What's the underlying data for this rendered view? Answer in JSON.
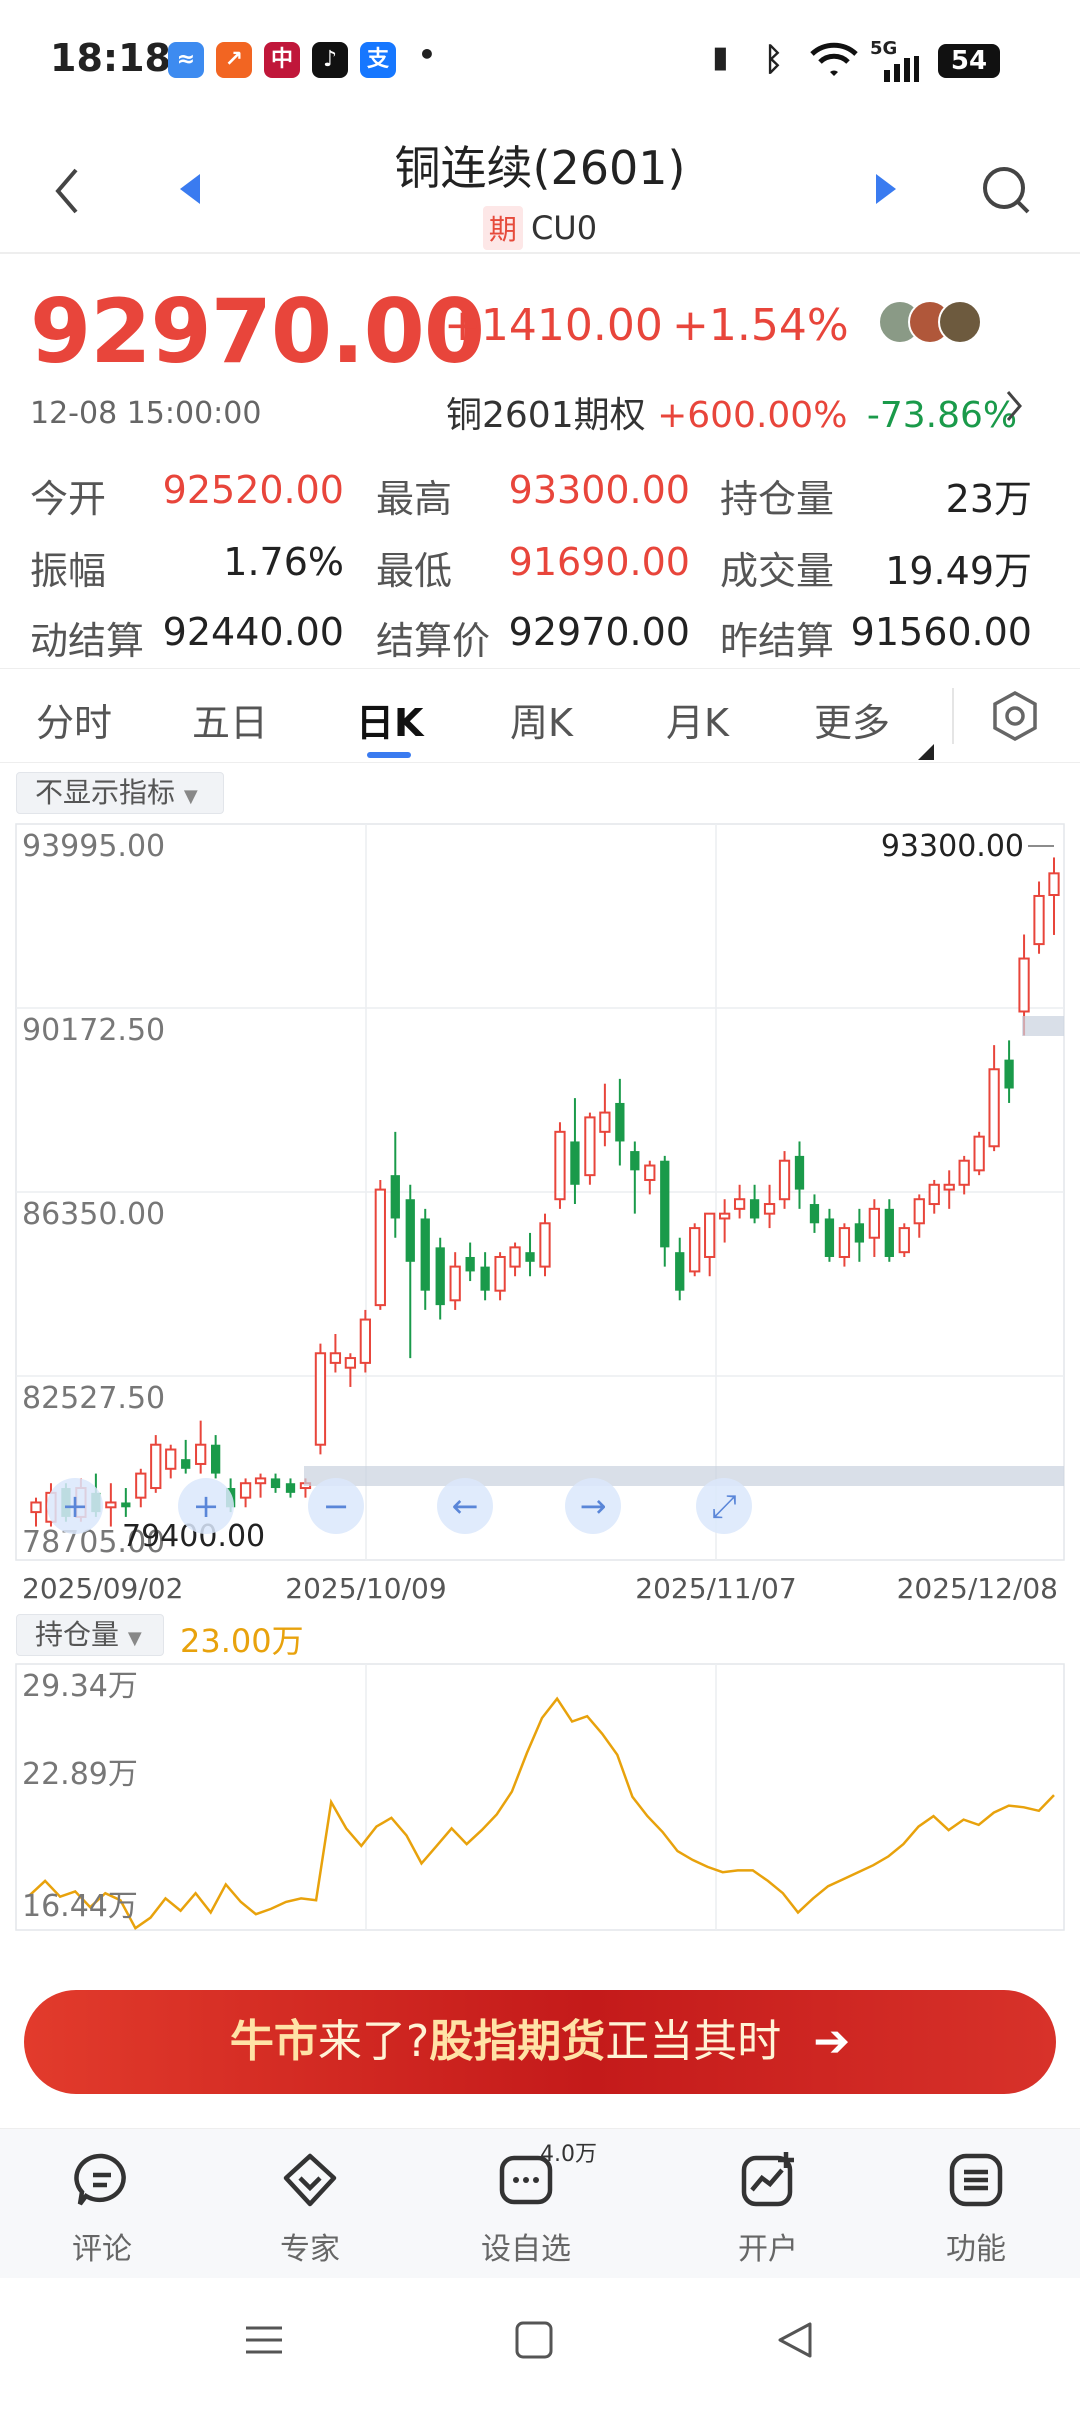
{
  "status_bar": {
    "time": "18:18",
    "battery": "54",
    "signal": "5G",
    "app_icons": [
      {
        "name": "app-icon-blue",
        "color": "#3d8bf0",
        "glyph": "≈"
      },
      {
        "name": "app-icon-orange",
        "color": "#f26522",
        "glyph": "↗"
      },
      {
        "name": "app-icon-red",
        "color": "#c0173a",
        "glyph": "中"
      },
      {
        "name": "app-icon-tiktok",
        "color": "#111111",
        "glyph": "♪"
      },
      {
        "name": "app-icon-alipay",
        "color": "#1677ff",
        "glyph": "支"
      }
    ]
  },
  "nav": {
    "title": "铜连续(2601)",
    "tag": "期",
    "code": "CU0"
  },
  "quote": {
    "price": "92970.00",
    "change": "+1410.00",
    "change_pct": "+1.54%",
    "datetime": "12-08 15:00:00",
    "option_label": "铜2601期权",
    "option_up": "+600.00%",
    "option_down": "-73.86%"
  },
  "stats": [
    [
      {
        "label": "今开",
        "value": "92520.00",
        "color": "red"
      },
      {
        "label": "最高",
        "value": "93300.00",
        "color": "red"
      },
      {
        "label": "持仓量",
        "value": "23万",
        "color": "dark"
      }
    ],
    [
      {
        "label": "振幅",
        "value": "1.76%",
        "color": "dark"
      },
      {
        "label": "最低",
        "value": "91690.00",
        "color": "red"
      },
      {
        "label": "成交量",
        "value": "19.49万",
        "color": "dark"
      }
    ],
    [
      {
        "label": "动结算",
        "value": "92440.00",
        "color": "dark"
      },
      {
        "label": "结算价",
        "value": "92970.00",
        "color": "dark"
      },
      {
        "label": "昨结算",
        "value": "91560.00",
        "color": "dark"
      }
    ]
  ],
  "tabs": [
    "分时",
    "五日",
    "日K",
    "周K",
    "月K",
    "更多"
  ],
  "active_tab": "日K",
  "indicator_label": "不显示指标",
  "chart_data": [
    {
      "type": "candlestick",
      "title": "",
      "y_ticks": [
        "93995.00",
        "90172.50",
        "86350.00",
        "82527.50",
        "78705.00"
      ],
      "ylim": [
        78705,
        93995
      ],
      "x_ticks": [
        "2025/09/02",
        "2025/10/09",
        "2025/11/07",
        "2025/12/08"
      ],
      "annotations": {
        "high_label": "93300.00",
        "low_label": "79400.00"
      },
      "candles": [
        [
          79700,
          80000,
          79400,
          79900
        ],
        [
          79500,
          80300,
          79400,
          80100
        ],
        [
          80200,
          80300,
          79500,
          79600
        ],
        [
          79600,
          80400,
          79500,
          80200
        ],
        [
          80100,
          80500,
          79600,
          79700
        ],
        [
          79800,
          80300,
          79400,
          79900
        ],
        [
          79900,
          80200,
          79600,
          79800
        ],
        [
          80000,
          80600,
          79800,
          80500
        ],
        [
          80200,
          81300,
          80100,
          81100
        ],
        [
          80600,
          81100,
          80400,
          81000
        ],
        [
          80800,
          81200,
          80500,
          80600
        ],
        [
          80700,
          81600,
          80500,
          81100
        ],
        [
          81100,
          81300,
          80400,
          80500
        ],
        [
          80200,
          80400,
          79700,
          79800
        ],
        [
          80000,
          80400,
          79800,
          80300
        ],
        [
          80300,
          80500,
          80000,
          80400
        ],
        [
          80400,
          80500,
          80100,
          80200
        ],
        [
          80300,
          80400,
          80000,
          80100
        ],
        [
          80200,
          80400,
          80000,
          80300
        ],
        [
          81100,
          83200,
          80900,
          83000
        ],
        [
          82800,
          83400,
          82600,
          83000
        ],
        [
          82700,
          83000,
          82300,
          82900
        ],
        [
          82800,
          83900,
          82600,
          83700
        ],
        [
          84000,
          86600,
          83900,
          86400
        ],
        [
          86700,
          87600,
          85400,
          85800
        ],
        [
          86200,
          86500,
          82900,
          84900
        ],
        [
          85800,
          86000,
          83900,
          84300
        ],
        [
          85200,
          85400,
          83700,
          84000
        ],
        [
          84100,
          85100,
          83900,
          84800
        ],
        [
          85000,
          85300,
          84500,
          84700
        ],
        [
          84800,
          85100,
          84100,
          84300
        ],
        [
          84300,
          85100,
          84100,
          85000
        ],
        [
          84800,
          85300,
          84600,
          85200
        ],
        [
          85100,
          85500,
          84600,
          84900
        ],
        [
          84800,
          85900,
          84600,
          85700
        ],
        [
          86200,
          87800,
          86000,
          87600
        ],
        [
          87400,
          88300,
          86100,
          86500
        ],
        [
          86700,
          88000,
          86500,
          87900
        ],
        [
          87600,
          88600,
          87300,
          88000
        ],
        [
          88200,
          88700,
          86900,
          87400
        ],
        [
          87200,
          87400,
          85900,
          86800
        ],
        [
          86600,
          87000,
          86300,
          86900
        ],
        [
          87000,
          87100,
          84800,
          85200
        ],
        [
          85100,
          85400,
          84100,
          84300
        ],
        [
          84700,
          85700,
          84600,
          85600
        ],
        [
          85000,
          85900,
          84600,
          85900
        ],
        [
          85800,
          86200,
          85300,
          85900
        ],
        [
          86000,
          86500,
          85800,
          86200
        ],
        [
          86200,
          86500,
          85700,
          85800
        ],
        [
          85900,
          86500,
          85600,
          86100
        ],
        [
          86200,
          87200,
          86000,
          87000
        ],
        [
          87100,
          87400,
          86000,
          86400
        ],
        [
          86100,
          86300,
          85500,
          85700
        ],
        [
          85800,
          86000,
          84900,
          85000
        ],
        [
          85000,
          85700,
          84800,
          85600
        ],
        [
          85700,
          86000,
          84900,
          85300
        ],
        [
          85400,
          86200,
          85000,
          86000
        ],
        [
          86000,
          86200,
          84900,
          85000
        ],
        [
          85100,
          85700,
          85000,
          85600
        ],
        [
          85700,
          86300,
          85400,
          86200
        ],
        [
          86100,
          86600,
          85900,
          86500
        ],
        [
          86400,
          86800,
          86000,
          86500
        ],
        [
          86500,
          87100,
          86300,
          87000
        ],
        [
          86800,
          87600,
          86700,
          87500
        ],
        [
          87300,
          89400,
          87200,
          88900
        ],
        [
          89100,
          89500,
          88200,
          88500
        ],
        [
          90100,
          91700,
          89600,
          91200
        ],
        [
          91500,
          92800,
          91300,
          92500
        ],
        [
          92520,
          93300,
          91690,
          92970
        ]
      ]
    },
    {
      "type": "line",
      "title": "",
      "series_label": "持仓量",
      "y_ticks": [
        "29.34万",
        "22.89万",
        "16.44万"
      ],
      "ylim": [
        16.44,
        29.34
      ],
      "values": [
        17.3,
        18.1,
        17.2,
        17.5,
        16.6,
        17.4,
        17.0,
        15.4,
        16.0,
        17.1,
        16.4,
        17.4,
        16.3,
        17.9,
        16.9,
        16.2,
        16.5,
        16.9,
        17.1,
        17.0,
        22.6,
        21.1,
        20.1,
        21.2,
        21.7,
        20.7,
        19.1,
        20.1,
        21.1,
        20.2,
        21.0,
        21.9,
        23.2,
        25.4,
        27.4,
        28.5,
        27.2,
        27.5,
        26.5,
        25.3,
        22.9,
        21.8,
        20.9,
        19.8,
        19.3,
        18.9,
        18.6,
        18.7,
        18.7,
        18.1,
        17.4,
        16.3,
        17.1,
        17.8,
        18.2,
        18.6,
        19.0,
        19.5,
        20.2,
        21.2,
        21.8,
        21.0,
        21.6,
        21.3,
        22.0,
        22.4,
        22.3,
        22.1,
        23.0
      ],
      "header_value": "23.00万"
    }
  ],
  "banner": {
    "part1": "牛市",
    "part2": "来了?",
    "part3": "股指期货",
    "part4": "正当其时",
    "arrow": "➔"
  },
  "bottom_nav": [
    {
      "label": "评论",
      "icon": "comment-icon"
    },
    {
      "label": "专家",
      "icon": "expert-icon"
    },
    {
      "label": "设自选",
      "icon": "watchlist-icon"
    },
    {
      "label": "开户",
      "icon": "open-account-icon"
    },
    {
      "label": "功能",
      "icon": "menu-icon"
    }
  ],
  "watchlist_badge": "4.0万",
  "colors": {
    "up": "#e8453b",
    "down": "#1a9a4a",
    "oi_line": "#e8a20c",
    "accent": "#3a7bf0"
  }
}
